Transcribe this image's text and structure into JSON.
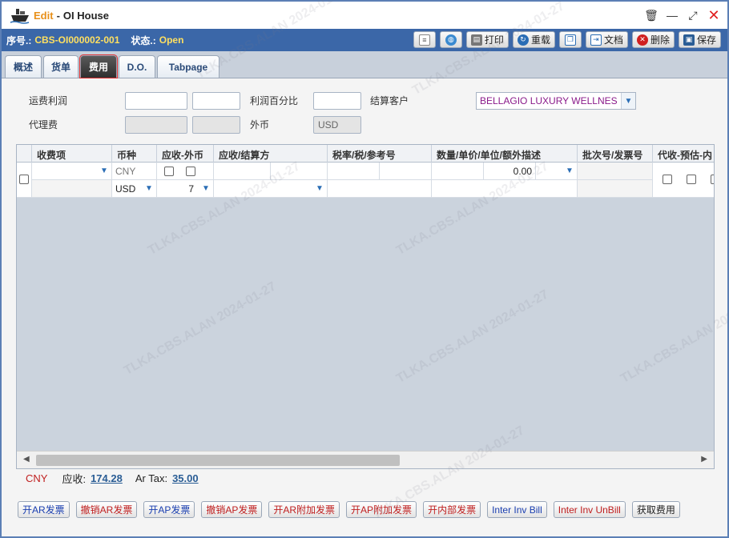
{
  "window": {
    "mode": "Edit",
    "separator": "-",
    "title": "OI House"
  },
  "info": {
    "serial_label": "序号.:",
    "serial_value": "CBS-OI000002-001",
    "status_label": "状态.:",
    "status_value": "Open"
  },
  "toolbar": {
    "print": "打印",
    "reload": "重载",
    "document": "文档",
    "delete": "删除",
    "save": "保存"
  },
  "tabs": [
    "概述",
    "货单",
    "费用",
    "D.O.",
    "Tabpage"
  ],
  "form": {
    "freight_profit_label": "运费利润",
    "profit_pct_label": "利润百分比",
    "settle_customer_label": "结算客户",
    "settle_customer_value": "BELLAGIO LUXURY WELLNES",
    "agency_fee_label": "代理费",
    "foreign_currency_label": "外币",
    "foreign_currency_value": "USD"
  },
  "grid": {
    "headers": [
      "收费项",
      "币种",
      "应收-外币",
      "应收/结算方",
      "税率/税/参考号",
      "数量/单价/单位/额外描述",
      "批次号/发票号",
      "代收-预估-内"
    ],
    "row": {
      "currency_top": "CNY",
      "currency_bottom": "USD",
      "ar_number": "7",
      "amount": "0.00"
    }
  },
  "summary": {
    "currency": "CNY",
    "ar_label": "应收:",
    "ar_value": "174.28",
    "tax_label": "Ar Tax:",
    "tax_value": "35.00"
  },
  "actions": {
    "open_ar": "开AR发票",
    "cancel_ar": "撤销AR发票",
    "open_ap": "开AP发票",
    "cancel_ap": "撤销AP发票",
    "open_ar_extra": "开AR附加发票",
    "open_ap_extra": "开AP附加发票",
    "open_internal": "开内部发票",
    "inter_inv_bill": "Inter Inv Bill",
    "inter_inv_unbill": "Inter Inv UnBill",
    "get_fees": "获取费用"
  },
  "watermark": "TLKA.CBS.ALAN 2024-01-27",
  "colors": {
    "accent": "#3b67a8",
    "edit": "#e8901a",
    "status": "#ffe060",
    "link": "#2a5d95"
  }
}
